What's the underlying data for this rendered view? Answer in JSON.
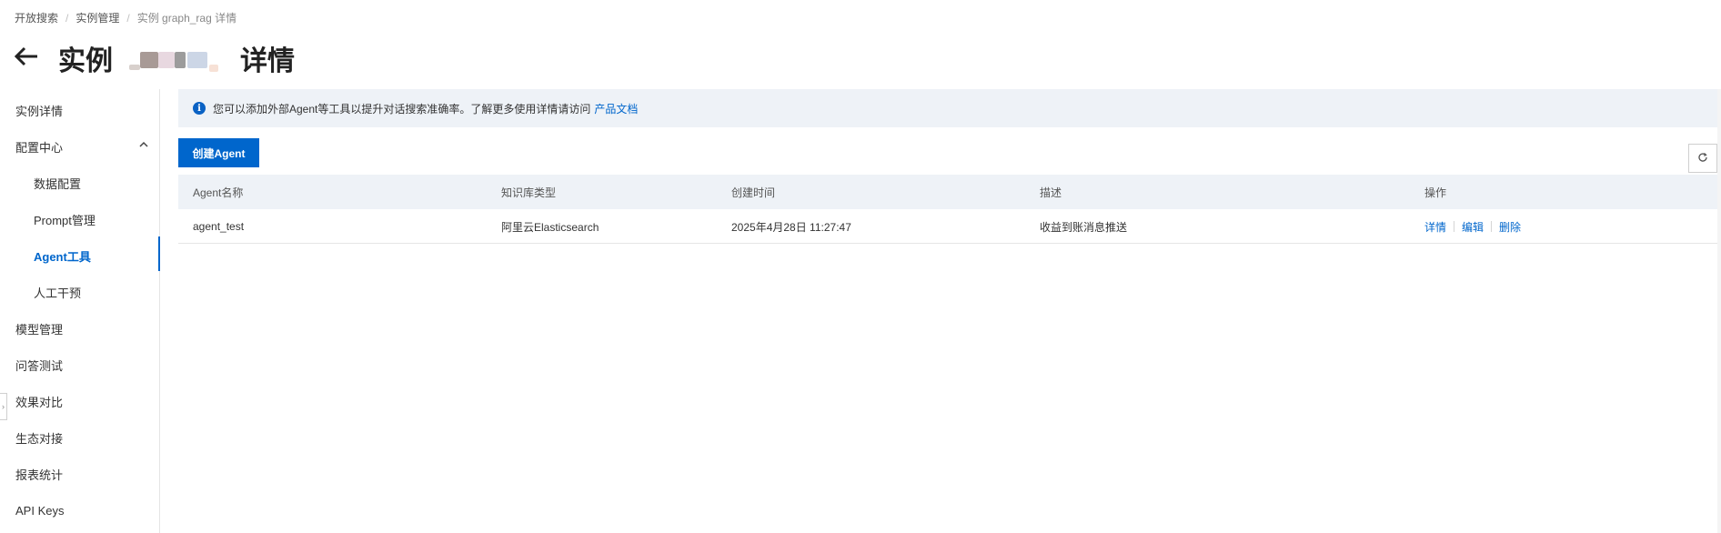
{
  "breadcrumb": {
    "items": [
      "开放搜索",
      "实例管理"
    ],
    "separator": "/",
    "current": "实例 graph_rag 详情"
  },
  "header": {
    "back_icon": "arrow-left-icon",
    "title_prefix": "实例",
    "title_suffix": "详情"
  },
  "sidebar": {
    "items": [
      {
        "label": "实例详情"
      },
      {
        "label": "配置中心",
        "expanded": true
      },
      {
        "label": "数据配置"
      },
      {
        "label": "Prompt管理"
      },
      {
        "label": "Agent工具",
        "active": true
      },
      {
        "label": "人工干预"
      },
      {
        "label": "模型管理"
      },
      {
        "label": "问答测试"
      },
      {
        "label": "效果对比"
      },
      {
        "label": "生态对接"
      },
      {
        "label": "报表统计"
      },
      {
        "label": "API Keys"
      }
    ],
    "chevron_icon": "chevron-up-icon",
    "collapse_icon": "chevron-right-icon"
  },
  "notice": {
    "icon": "info-icon",
    "text": "您可以添加外部Agent等工具以提升对话搜索准确率。了解更多使用详情请访问",
    "link": "产品文档"
  },
  "toolbar": {
    "create_label": "创建Agent",
    "refresh_icon": "refresh-icon"
  },
  "table": {
    "columns": [
      "Agent名称",
      "知识库类型",
      "创建时间",
      "描述",
      "操作"
    ],
    "rows": [
      {
        "name": "agent_test",
        "kb_type": "阿里云Elasticsearch",
        "created": "2025年4月28日 11:27:47",
        "desc": "收益到账消息推送",
        "actions": [
          "详情",
          "编辑",
          "删除"
        ]
      }
    ]
  },
  "colors": {
    "accent": "#0066cc",
    "notice_bg": "#eef2f7"
  }
}
